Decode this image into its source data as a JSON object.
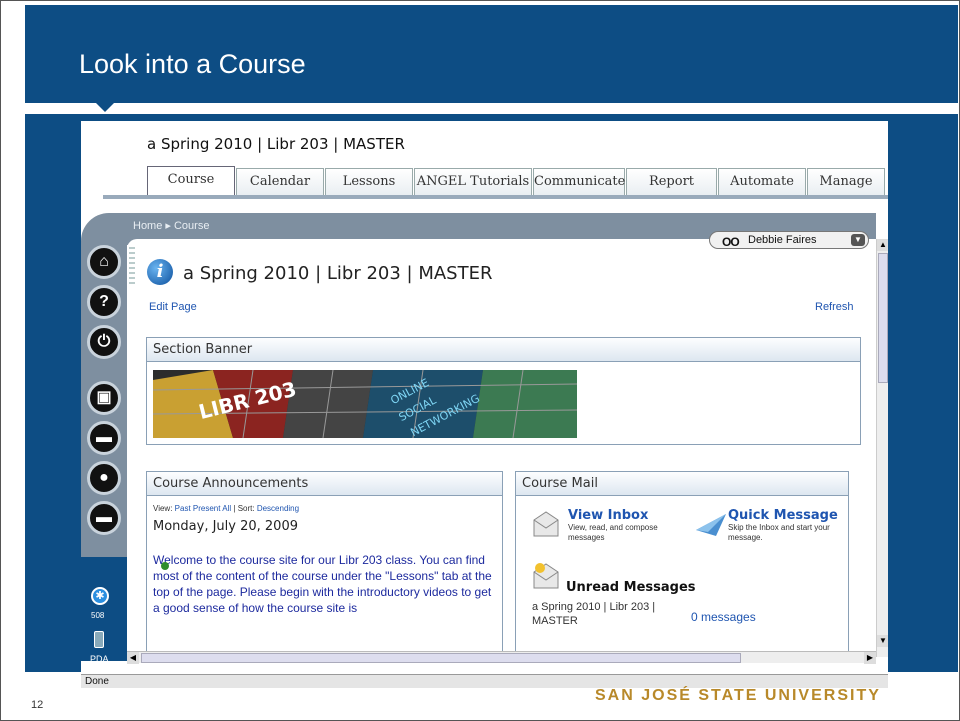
{
  "slide": {
    "title": "Look into a Course",
    "number": "12",
    "university": "SAN JOSÉ STATE UNIVERSITY",
    "colors": {
      "band": "#0d4d84",
      "university": "#b8892a"
    }
  },
  "course": {
    "name": "a Spring 2010 | Libr 203 | MASTER",
    "tabs": [
      "Course",
      "Calendar",
      "Lessons",
      "ANGEL Tutorials",
      "Communicate",
      "Report",
      "Automate",
      "Manage"
    ],
    "active_tab": "Course"
  },
  "nav": {
    "breadcrumb_home": "Home",
    "breadcrumb_current": "Course",
    "user": "Debbie Faires"
  },
  "rail": {
    "buttons": [
      "home-icon",
      "help-icon",
      "power-icon",
      "briefcase-icon",
      "folder-icon",
      "profile-icon",
      "chat-icon"
    ],
    "accessibility_label": "508",
    "pda_label": "PDA"
  },
  "page": {
    "title": "a Spring 2010 | Libr 203 | MASTER",
    "edit_link": "Edit Page",
    "refresh_link": "Refresh"
  },
  "banner": {
    "title": "Section Banner",
    "image_text": [
      "LIBR 203",
      "ONLINE",
      "SOCIAL",
      "NETWORKING"
    ]
  },
  "announcements": {
    "title": "Course Announcements",
    "view_label": "View:",
    "views": [
      "Past",
      "Present",
      "All"
    ],
    "sort_label": "| Sort:",
    "sort_value": "Descending",
    "date": "Monday, July 20, 2009",
    "text": "Welcome to the course site for our Libr 203 class. You can find most of the content of the course under the \"Lessons\" tab at the top of the page. Please begin with the introductory videos to get a good sense of how the course site is"
  },
  "mail": {
    "title": "Course Mail",
    "view_inbox": "View Inbox",
    "view_inbox_desc": "View, read, and compose messages",
    "quick_message": "Quick Message",
    "quick_message_desc": "Skip the Inbox and start your message.",
    "unread_title": "Unread Messages",
    "unread_course": "a Spring 2010 | Libr 203 | MASTER",
    "unread_count": "0 messages"
  },
  "status": {
    "text": "Done"
  }
}
